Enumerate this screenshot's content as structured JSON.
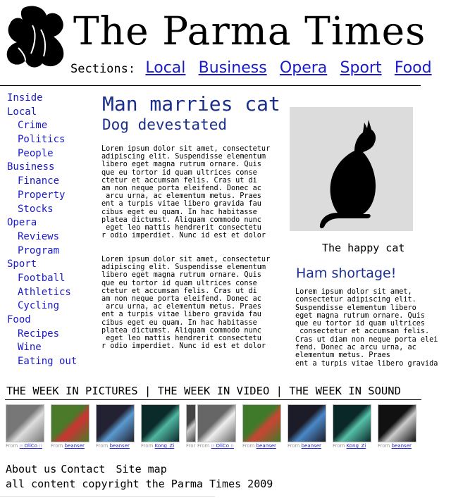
{
  "masthead": {
    "title": "The Parma Times"
  },
  "sections": {
    "label": "Sections:",
    "links": [
      "Local",
      "Business",
      "Opera",
      "Sport",
      "Food"
    ]
  },
  "nav": {
    "items": [
      {
        "label": "Inside",
        "level": 0
      },
      {
        "label": "Local",
        "level": 0
      },
      {
        "label": "Crime",
        "level": 1
      },
      {
        "label": "Politics",
        "level": 1
      },
      {
        "label": "People",
        "level": 1
      },
      {
        "label": "Business",
        "level": 0
      },
      {
        "label": "Finance",
        "level": 1
      },
      {
        "label": "Property",
        "level": 1
      },
      {
        "label": "Stocks",
        "level": 1
      },
      {
        "label": "Opera",
        "level": 0
      },
      {
        "label": "Reviews",
        "level": 1
      },
      {
        "label": "Program",
        "level": 1
      },
      {
        "label": "Sport",
        "level": 0
      },
      {
        "label": "Football",
        "level": 1
      },
      {
        "label": "Athletics",
        "level": 1
      },
      {
        "label": "Cycling",
        "level": 1
      },
      {
        "label": "Food",
        "level": 0
      },
      {
        "label": "Recipes",
        "level": 1
      },
      {
        "label": "Wine",
        "level": 1
      },
      {
        "label": "Eating out",
        "level": 1
      }
    ]
  },
  "story": {
    "headline": "Man marries cat",
    "subhead": "Dog devestated",
    "paragraph1": "Lorem ipsum dolor sit amet, consectetur\nadipiscing elit. Suspendisse elementum\nlibero eget magna rutrum ornare. Quis\nque eu tortor id quam ultrices conse\nctetur et accumsan felis. Cras ut di\nam non neque porta eleifend. Donec ac\n arcu urna, ac elementum metus. Praes\nent a turpis vitae libero gravida fau\ncibus eget eu quam. In hac habitasse\nplatea dictumst. Aliquam commodo nunc\n eget leo mattis hendrerit consectetu\nr odio imperdiet. Nunc id est et dolor",
    "paragraph2": "Lorem ipsum dolor sit amet, consectetur\nadipiscing elit. Suspendisse elementum\nlibero eget magna rutrum ornare. Quis\nque eu tortor id quam ultrices conse\nctetur et accumsan felis. Cras ut di\nam non neque porta eleifend. Donec ac\n arcu urna, ac elementum metus. Praes\nent a turpis vitae libero gravida fau\ncibus eget eu quam. In hac habitasse\nplatea dictumst. Aliquam commodo nunc\n eget leo mattis hendrerit consectetu\nr odio imperdiet. Nunc id est et dolor"
  },
  "photo": {
    "caption": "The happy cat"
  },
  "ham": {
    "headline": "Ham shortage!",
    "text": "Lorem ipsum dolor sit amet,\nconsectetur adipiscing elit.\nSuspendisse elementum libero\neget magna rutrum ornare. Quis\nque eu tortor id quam ultrices\n consectetur et accumsan felis.\nCras ut diam non neque porta elei\nfend. Donec ac arcu urna, ac\nelementum metus. Praes\nent a turpis vitae libero gravida"
  },
  "week": {
    "label": "THE WEEK IN PICTURES | THE WEEK IN VIDEO | THE WEEK IN SOUND"
  },
  "thumbnails": [
    {
      "from": "From",
      "author": ":: OliCo ::",
      "colors": [
        "#777",
        "#ddd"
      ]
    },
    {
      "from": "From",
      "author": "beanser",
      "colors": [
        "#4a7a2a",
        "#c33"
      ]
    },
    {
      "from": "From",
      "author": "beanser",
      "colors": [
        "#223",
        "#5a9ad0"
      ]
    },
    {
      "from": "From",
      "author": "Kong_Zi",
      "colors": [
        "#0b2a2a",
        "#4fb5a0"
      ]
    },
    {
      "from": "Fror",
      "author": "",
      "colors": [
        "#444",
        "#ccc"
      ]
    },
    {
      "from": "From",
      "author": ":: OliCo ::",
      "colors": [
        "#666",
        "#eee"
      ]
    },
    {
      "from": "From",
      "author": "beanser",
      "colors": [
        "#3f7a2a",
        "#c43"
      ]
    },
    {
      "from": "From",
      "author": "beanser",
      "colors": [
        "#1c1c28",
        "#4a88c8"
      ]
    },
    {
      "from": "From",
      "author": "Kong_Zi",
      "colors": [
        "#0a2828",
        "#56c0a8"
      ]
    },
    {
      "from": "From",
      "author": "beanser",
      "colors": [
        "#111",
        "#ccc"
      ]
    }
  ],
  "footer": {
    "links": [
      "About us",
      "Contact",
      " Site map"
    ],
    "copyright": "all content copyright the Parma Times 2009"
  }
}
